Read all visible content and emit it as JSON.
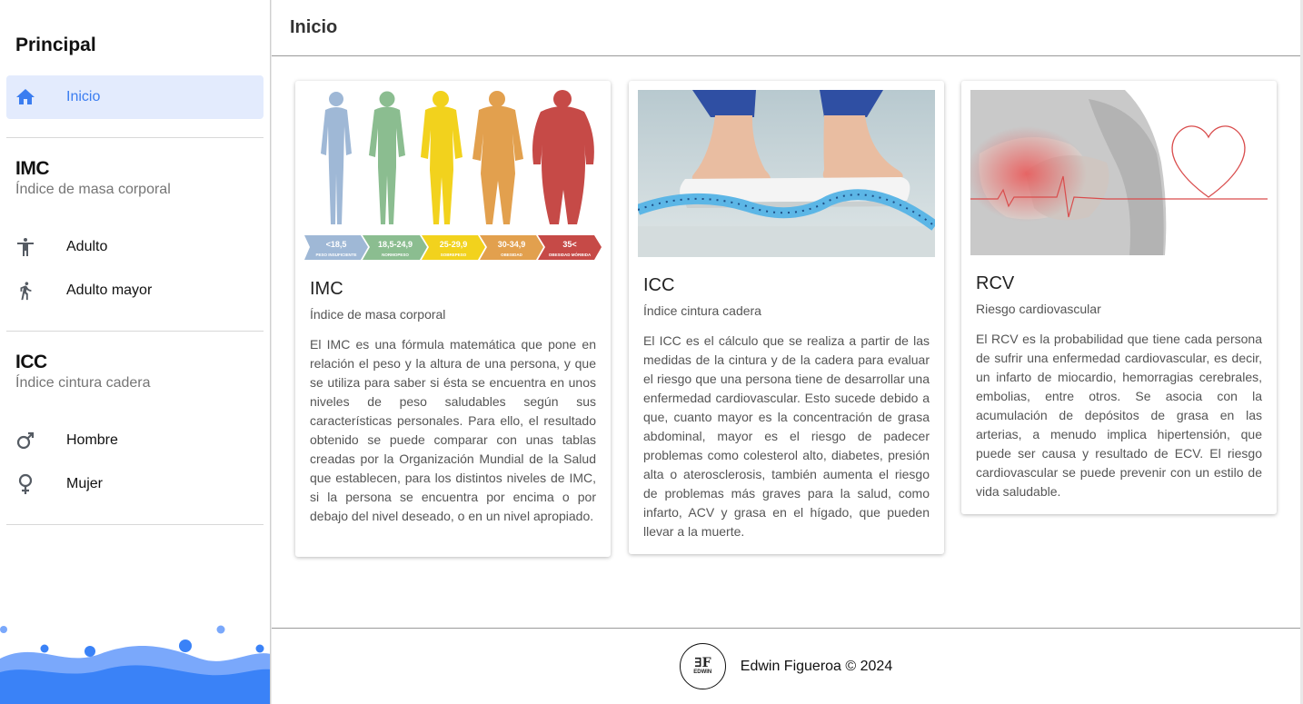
{
  "sidebar": {
    "title": "Principal",
    "home_label": "Inicio",
    "sections": [
      {
        "heading": "IMC",
        "subtitle": "Índice de masa corporal",
        "items": [
          {
            "label": "Adulto",
            "icon": "accessibility-icon"
          },
          {
            "label": "Adulto mayor",
            "icon": "walking-icon"
          }
        ]
      },
      {
        "heading": "ICC",
        "subtitle": "Índice cintura cadera",
        "items": [
          {
            "label": "Hombre",
            "icon": "male-icon"
          },
          {
            "label": "Mujer",
            "icon": "female-icon"
          }
        ]
      }
    ]
  },
  "header": {
    "title": "Inicio"
  },
  "cards": [
    {
      "title": "IMC",
      "subtitle": "Índice de masa corporal",
      "text": "El IMC es una fórmula matemática que pone en relación el peso y la altura de una persona, y que se utiliza para saber si ésta se encuentra en unos niveles de peso saludables según sus características personales. Para ello, el resultado obtenido se puede comparar con unas tablas creadas por la Organización Mundial de la Salud que establecen, para los distintos niveles de IMC, si la persona se encuentra por encima o por debajo del nivel deseado, o en un nivel apropiado.",
      "image_labels": [
        {
          "range": "<18,5",
          "label": "PESO INSUFICIENTE",
          "color": "#9fb8d6"
        },
        {
          "range": "18,5-24,9",
          "label": "NORMOPESO",
          "color": "#8bbd90"
        },
        {
          "range": "25-29,9",
          "label": "SOBREPESO",
          "color": "#f2d21d"
        },
        {
          "range": "30-34,9",
          "label": "OBESIDAD",
          "color": "#e2a04e"
        },
        {
          "range": "35<",
          "label": "OBESIDAD MÓRBIDA",
          "color": "#c64a47"
        }
      ]
    },
    {
      "title": "ICC",
      "subtitle": "Índice cintura cadera",
      "text": "El ICC es el cálculo que se realiza a partir de las medidas de la cintura y de la cadera para evaluar el riesgo que una persona tiene de desarrollar una enfermedad cardiovascular. Esto sucede debido a que, cuanto mayor es la concentración de grasa abdominal, mayor es el riesgo de padecer problemas como colesterol alto, diabetes, presión alta o aterosclerosis, también aumenta el riesgo de problemas más graves para la salud, como infarto, ACV y grasa en el hígado, que pueden llevar a la muerte."
    },
    {
      "title": "RCV",
      "subtitle": "Riesgo cardiovascular",
      "text": "El RCV es la probabilidad que tiene cada persona de sufrir una enfermedad cardiovascular, es decir, un infarto de miocardio, hemorragias cerebrales, embolias, entre otros. Se asocia con la acumulación de depósitos de grasa en las arterias, a menudo implica hipertensión, que puede ser causa y resultado de ECV. El riesgo cardiovascular se puede prevenir con un estilo de vida saludable."
    }
  ],
  "footer": {
    "text": "Edwin Figueroa © 2024",
    "logo_mark": "∃F",
    "logo_name": "EDWIN"
  },
  "colors": {
    "accent": "#3b7df0",
    "active_bg": "#e3ebfd",
    "wave": "#3a82f7",
    "icon": "#555b63"
  }
}
